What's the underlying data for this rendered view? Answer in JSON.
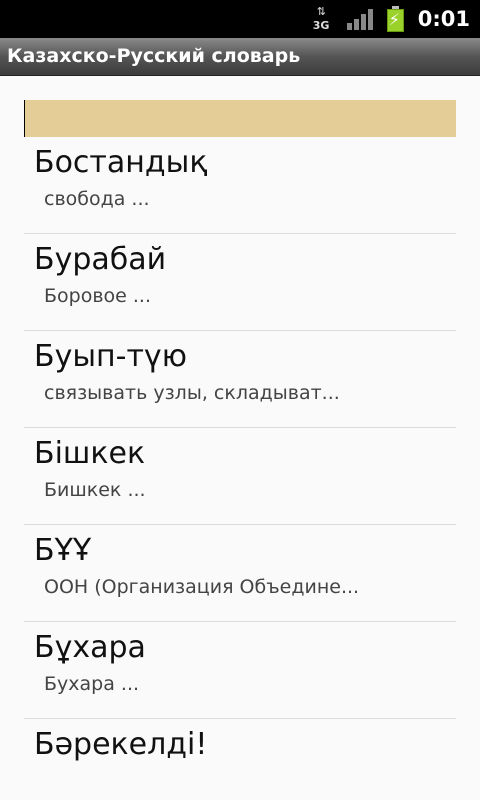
{
  "status_bar": {
    "network_label": "3G",
    "network_arrows": "⇅",
    "battery_icon": "battery-charging-icon",
    "time": "0:01"
  },
  "title_bar": {
    "title": "Казахско-Русский словарь"
  },
  "search": {
    "value": "",
    "placeholder": ""
  },
  "entries": [
    {
      "word": "Бостандық",
      "translation": "свобода ..."
    },
    {
      "word": "Бурабай",
      "translation": "Боровое ..."
    },
    {
      "word": "Буып-түю",
      "translation": "связывать узлы, складыват..."
    },
    {
      "word": "Бішкек",
      "translation": "Бишкек ..."
    },
    {
      "word": "БҰҰ",
      "translation": "ООН (Организация Объедине..."
    },
    {
      "word": "Бұхара",
      "translation": "Бухара ..."
    },
    {
      "word": "Бәрекелді!",
      "translation": ""
    }
  ],
  "colors": {
    "search_field_bg": "#e4cd96",
    "battery_green": "#9bd12b"
  }
}
